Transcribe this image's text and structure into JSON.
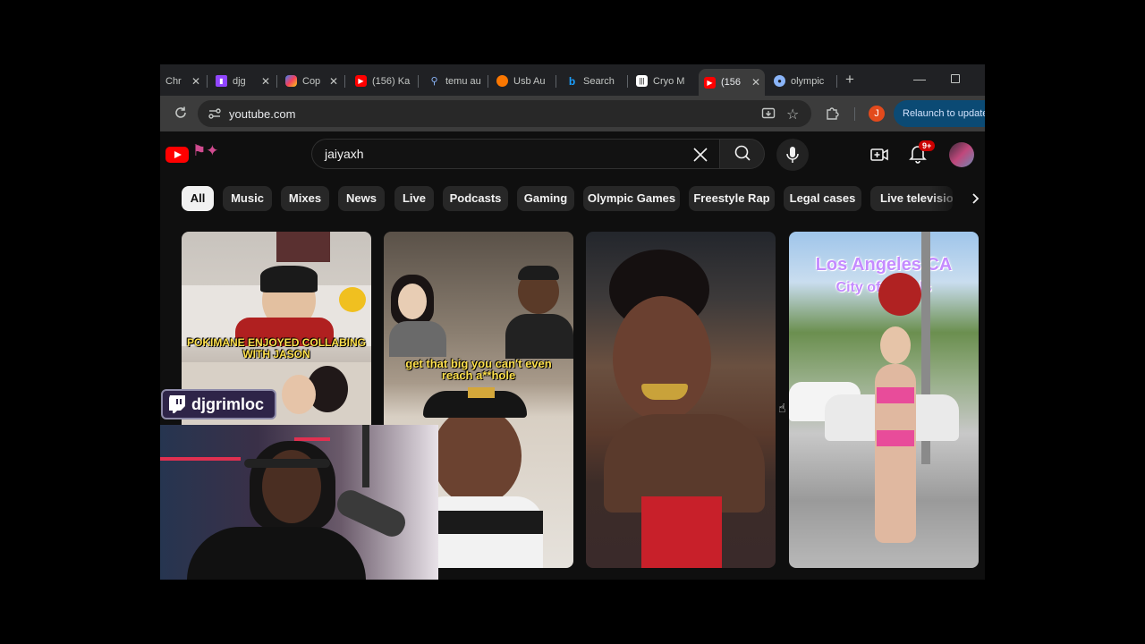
{
  "tabs": [
    {
      "title": "Chr",
      "favicon": "chrome-icon",
      "color": "#8ab4f8"
    },
    {
      "title": "djg",
      "favicon": "twitch-icon",
      "color": "#9146ff"
    },
    {
      "title": "Cop",
      "favicon": "copilot-icon",
      "color": "#3b82f6"
    },
    {
      "title": "(156) Ka",
      "favicon": "youtube-icon",
      "color": "#ff0000"
    },
    {
      "title": "temu au",
      "favicon": "search-icon",
      "color": "#8ab4f8"
    },
    {
      "title": "Usb Au",
      "favicon": "temu-icon",
      "color": "#fb7701"
    },
    {
      "title": "Search",
      "favicon": "bing-icon",
      "color": "#1a9fff"
    },
    {
      "title": "Cryo M",
      "favicon": "audio-wave-icon",
      "color": "#ffffff"
    },
    {
      "title": "(156",
      "favicon": "youtube-icon",
      "color": "#ff0000",
      "active": true
    },
    {
      "title": "olympic",
      "favicon": "google-lens-icon",
      "color": "#8ab4f8"
    }
  ],
  "toolbar": {
    "url": "youtube.com",
    "profile_initial": "J",
    "relaunch_label": "Relaunch to update"
  },
  "youtube": {
    "search_query": "jaiyaxh",
    "notification_count": "9+",
    "chips": [
      "All",
      "Music",
      "Mixes",
      "News",
      "Live",
      "Podcasts",
      "Gaming",
      "Olympic Games",
      "Freestyle Rap",
      "Legal cases",
      "Live televisio"
    ],
    "selected_chip": "All"
  },
  "shorts": [
    {
      "caption": "POKIMANE ENJOYED COLLABING WITH JASON"
    },
    {
      "caption": "get that big you can't even reach a**hole"
    },
    {
      "caption": ""
    },
    {
      "caption_line1": "Los Angeles CA",
      "caption_line2": "City of Angels"
    }
  ],
  "overlay": {
    "twitch_username": "djgrimloc"
  },
  "colors": {
    "yt_red": "#ff0000",
    "chip_selected_bg": "#f1f1f1",
    "chip_bg": "#272727",
    "relaunch_bg": "#0b4a74",
    "caption_yellow": "#ffe14d",
    "caption_purple": "#c48bff"
  }
}
